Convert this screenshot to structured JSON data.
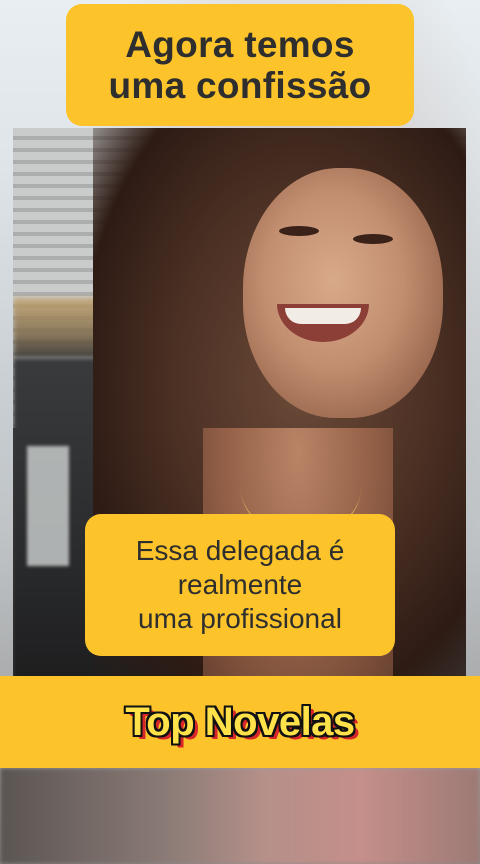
{
  "captions": {
    "top_line1": "Agora temos",
    "top_line2": "uma confissão",
    "mid_line1": "Essa delegada é",
    "mid_line2": "realmente",
    "mid_line3": "uma profissional"
  },
  "banner": {
    "title": "Top Novelas"
  },
  "colors": {
    "caption_bg": "#fcc42a",
    "caption_text": "#2e2e2e",
    "banner_text": "#ffe24a",
    "banner_outline": "#111111",
    "banner_shadow": "#d8262a"
  }
}
